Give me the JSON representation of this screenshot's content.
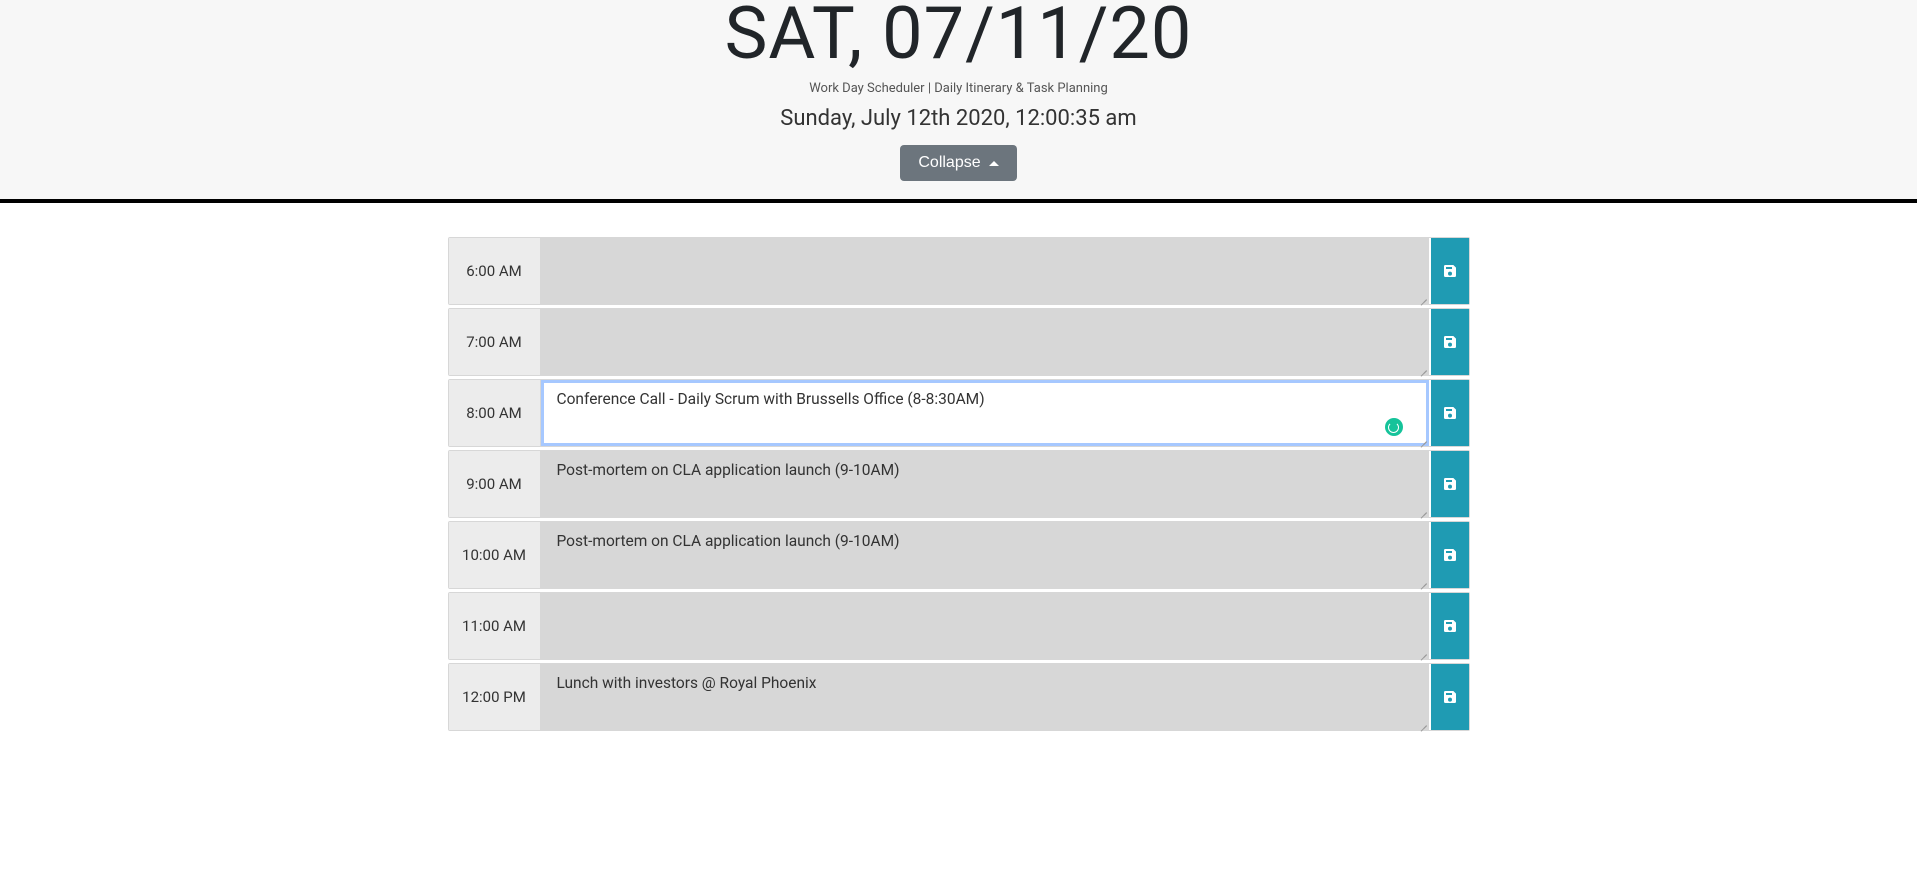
{
  "header": {
    "title": "SAT, 07/11/20",
    "subtitle": "Work Day Scheduler | Daily Itinerary & Task Planning",
    "current_time": "Sunday, July 12th 2020, 12:00:35 am",
    "collapse_label": "Collapse"
  },
  "rows": [
    {
      "hour": "6:00 AM",
      "task": "",
      "active": false
    },
    {
      "hour": "7:00 AM",
      "task": "",
      "active": false
    },
    {
      "hour": "8:00 AM",
      "task": "Conference Call - Daily Scrum with Brussells Office (8-8:30AM)",
      "active": true
    },
    {
      "hour": "9:00 AM",
      "task": "Post-mortem on CLA application launch (9-10AM)",
      "active": false
    },
    {
      "hour": "10:00 AM",
      "task": "Post-mortem on CLA application launch (9-10AM)",
      "active": false
    },
    {
      "hour": "11:00 AM",
      "task": "",
      "active": false
    },
    {
      "hour": "12:00 PM",
      "task": "Lunch with investors @ Royal Phoenix",
      "active": false
    }
  ]
}
